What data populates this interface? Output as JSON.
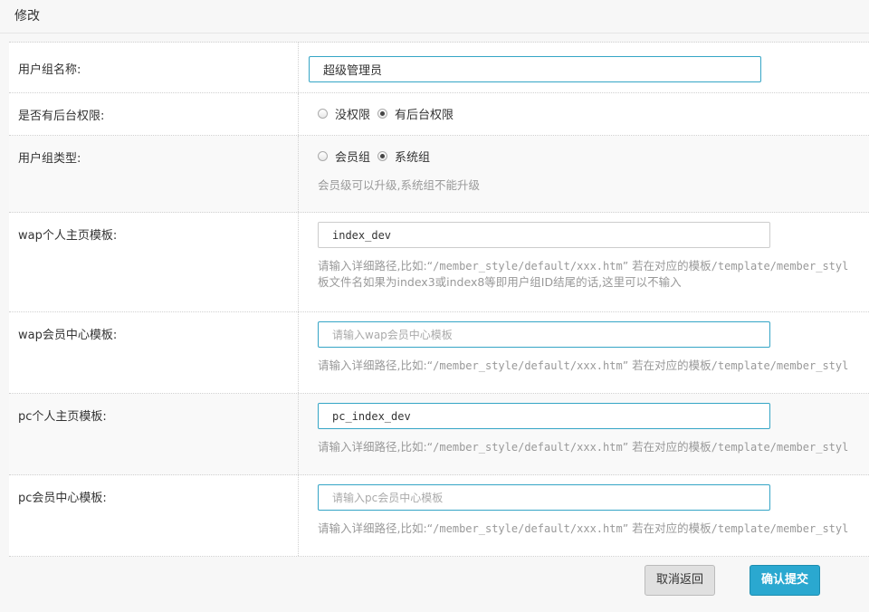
{
  "header": {
    "title": "修改"
  },
  "fields": {
    "group_name": {
      "label": "用户组名称:",
      "value": "超级管理员"
    },
    "backend": {
      "label": "是否有后台权限:",
      "options": [
        "没权限",
        "有后台权限"
      ],
      "selected": "有后台权限"
    },
    "group_type": {
      "label": "用户组类型:",
      "options": [
        "会员组",
        "系统组"
      ],
      "selected": "系统组",
      "help": "会员级可以升级,系统组不能升级"
    },
    "wap_home": {
      "label": "wap个人主页模板:",
      "value": "index_dev",
      "help_prefix": "请输入详细路径,比如:“",
      "help_code": "/member_style/default/xxx.htm",
      "help_mid": "” 若在对应的模板",
      "help_code2": "/template/member_styl",
      "help_line2": "板文件名如果为index3或index8等即用户组ID结尾的话,这里可以不输入"
    },
    "wap_member": {
      "label": "wap会员中心模板:",
      "placeholder": "请输入wap会员中心模板",
      "help_prefix": "请输入详细路径,比如:“",
      "help_code": "/member_style/default/xxx.htm",
      "help_mid": "” 若在对应的模板",
      "help_code2": "/template/member_styl"
    },
    "pc_home": {
      "label": "pc个人主页模板:",
      "value": "pc_index_dev",
      "help_prefix": "请输入详细路径,比如:“",
      "help_code": "/member_style/default/xxx.htm",
      "help_mid": "” 若在对应的模板",
      "help_code2": "/template/member_styl"
    },
    "pc_member": {
      "label": "pc会员中心模板:",
      "placeholder": "请输入pc会员中心模板",
      "help_prefix": "请输入详细路径,比如:“",
      "help_code": "/member_style/default/xxx.htm",
      "help_mid": "” 若在对应的模板",
      "help_code2": "/template/member_styl"
    }
  },
  "buttons": {
    "cancel": "取消返回",
    "submit": "确认提交"
  },
  "colors": {
    "accent": "#2aa8d0",
    "focus_border": "#35a5c6"
  }
}
